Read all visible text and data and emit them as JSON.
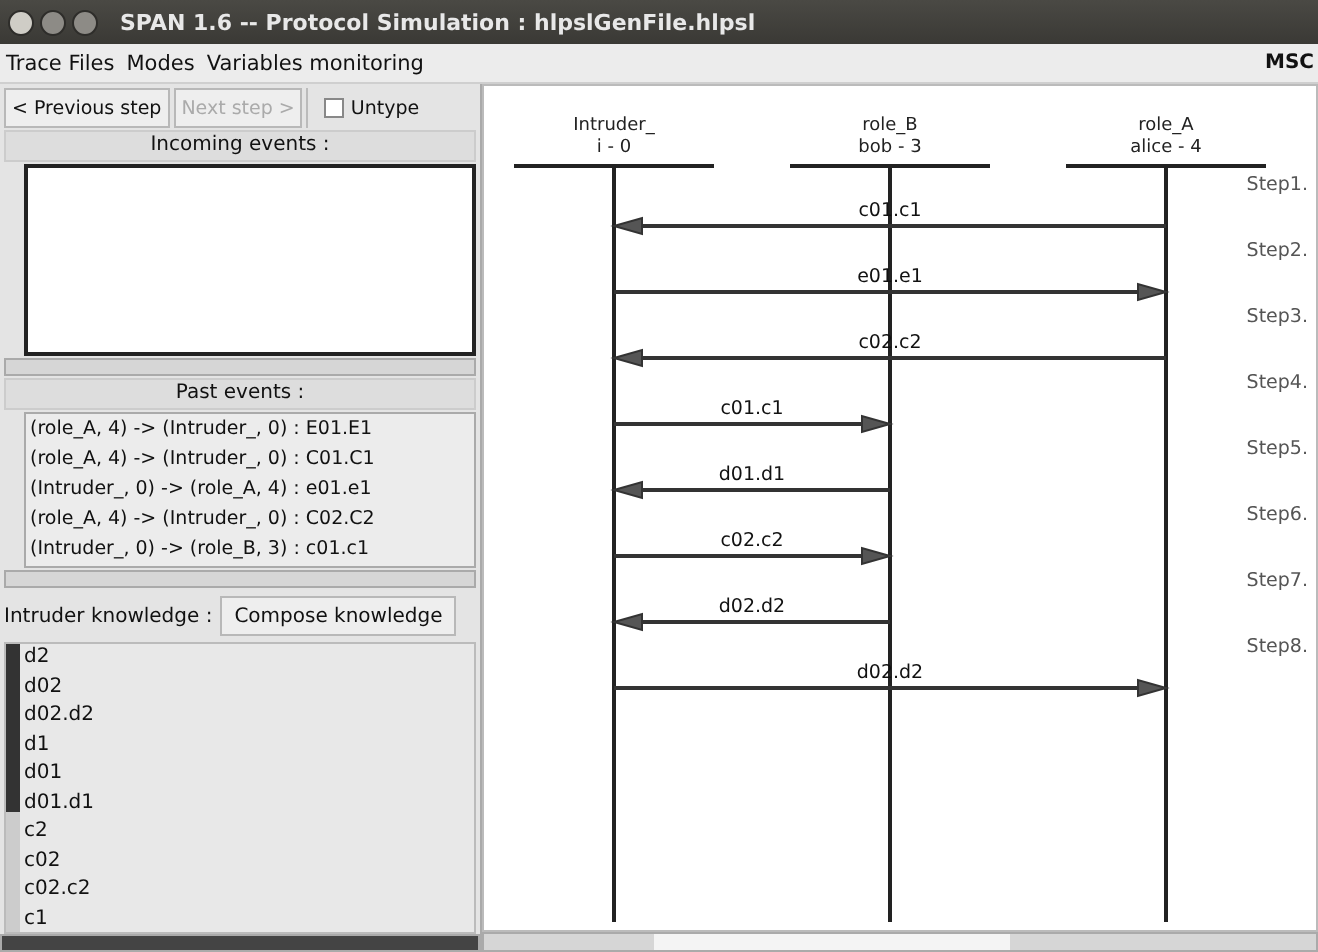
{
  "window": {
    "title": "SPAN 1.6 -- Protocol Simulation : hlpslGenFile.hlpsl"
  },
  "menu": [
    {
      "label": "Trace Files"
    },
    {
      "label": "Modes"
    },
    {
      "label": "Variables monitoring"
    }
  ],
  "msc_label": "MSC",
  "controls": {
    "previous": {
      "label": "< Previous step",
      "disabled": false
    },
    "next": {
      "label": "Next step >",
      "disabled": true
    },
    "untype": {
      "label": "Untype",
      "checked": false
    }
  },
  "incoming_events": {
    "title": "Incoming events :"
  },
  "past_events": {
    "title": "Past events :",
    "items": [
      "(role_A, 4) -> (Intruder_, 0) : E01.E1",
      "(role_A, 4) -> (Intruder_, 0) : C01.C1",
      "(Intruder_, 0) -> (role_A, 4) : e01.e1",
      "(role_A, 4) -> (Intruder_, 0) : C02.C2",
      "(Intruder_, 0) -> (role_B, 3) : c01.c1"
    ]
  },
  "intruder_knowledge": {
    "label": "Intruder knowledge :",
    "button": "Compose knowledge",
    "items": [
      "d2",
      "d02",
      "d02.d2",
      "d1",
      "d01",
      "d01.d1",
      "c2",
      "c02",
      "c02.c2",
      "c1"
    ]
  },
  "msc": {
    "lifelines": [
      {
        "name": "Intruder_",
        "instance": "i - 0"
      },
      {
        "name": "role_B",
        "instance": "bob - 3"
      },
      {
        "name": "role_A",
        "instance": "alice - 4"
      }
    ],
    "messages": [
      {
        "kind": "alice_to_intruder",
        "label": "c01.c1"
      },
      {
        "kind": "intruder_to_alice",
        "label": "e01.e1"
      },
      {
        "kind": "alice_to_intruder",
        "label": "c02.c2"
      },
      {
        "kind": "intruder_to_bob",
        "label": "c01.c1"
      },
      {
        "kind": "bob_to_intruder",
        "label": "d01.d1"
      },
      {
        "kind": "intruder_to_bob",
        "label": "c02.c2"
      },
      {
        "kind": "bob_to_intruder",
        "label": "d02.d2"
      },
      {
        "kind": "intruder_to_alice",
        "label": "d02.d2"
      }
    ],
    "steps": [
      "Step1.",
      "Step2.",
      "Step3.",
      "Step4.",
      "Step5.",
      "Step6.",
      "Step7.",
      "Step8."
    ]
  }
}
